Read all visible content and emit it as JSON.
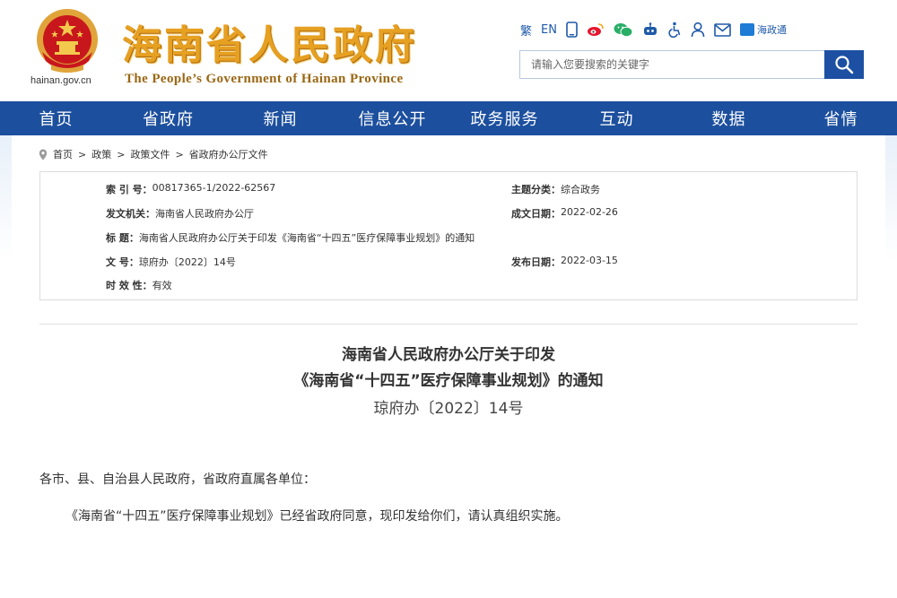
{
  "header": {
    "site_title": "海南省人民政府",
    "site_subtitle": "The People’s Government  of Hainan Province",
    "domain": "hainan.gov.cn",
    "tools": {
      "traditional": "繁",
      "english": "EN",
      "app_label": "海政通"
    },
    "search": {
      "placeholder": "请输入您要搜索的关键字"
    },
    "colors": {
      "nav": "#1c4f9e",
      "title": "#e6a022",
      "emblem": "#c8161d"
    }
  },
  "nav": {
    "items": [
      {
        "label": "首页"
      },
      {
        "label": "省政府"
      },
      {
        "label": "新闻"
      },
      {
        "label": "信息公开"
      },
      {
        "label": "政务服务"
      },
      {
        "label": "互动"
      },
      {
        "label": "数据"
      },
      {
        "label": "省情"
      }
    ]
  },
  "breadcrumb": {
    "items": [
      "首页",
      "政策",
      "政策文件",
      "省政府办公厅文件"
    ],
    "separator": ">"
  },
  "meta": {
    "index_key": "索  引 号：",
    "index_val": "00817365-1/2022-62567",
    "category_key": "主题分类：",
    "category_val": "综合政务",
    "issuer_key": "发文机关：",
    "issuer_val": "海南省人民政府办公厅",
    "created_key": "成文日期：",
    "created_val": "2022-02-26",
    "title_key": "标    题：",
    "title_val": "海南省人民政府办公厅关于印发《海南省“十四五”医疗保障事业规划》的通知",
    "docno_key": "文    号：",
    "docno_val": "琼府办〔2022〕14号",
    "published_key": "发布日期：",
    "published_val": "2022-03-15",
    "validity_key": "时  效  性：",
    "validity_val": "有效"
  },
  "document": {
    "title_line1": "海南省人民政府办公厅关于印发",
    "title_line2": "《海南省“十四五”医疗保障事业规划》的通知",
    "doc_number": "琼府办〔2022〕14号",
    "salutation": "各市、县、自治县人民政府，省政府直属各单位：",
    "body": "《海南省“十四五”医疗保障事业规划》已经省政府同意，现印发给你们，请认真组织实施。"
  }
}
